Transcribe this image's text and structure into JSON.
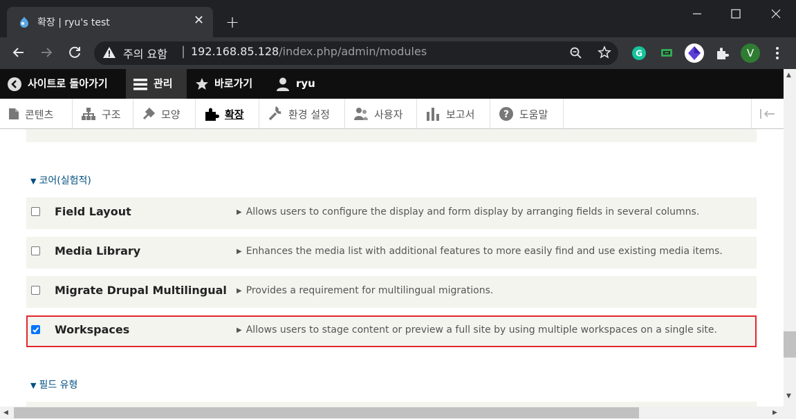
{
  "browser": {
    "tab_title": "확장 | ryu's test",
    "close_glyph": "✕",
    "new_tab_glyph": "+",
    "security_label": "주의 요함",
    "url_host": "192.168.85.128",
    "url_path": "/index.php/admin/modules",
    "profile_initial": "V"
  },
  "admin_toolbar": {
    "back_to_site": "사이트로 돌아가기",
    "manage": "관리",
    "shortcuts": "바로가기",
    "user": "ryu"
  },
  "tray": {
    "items": [
      {
        "label": "콘텐츠",
        "icon": "file-icon"
      },
      {
        "label": "구조",
        "icon": "structure-icon"
      },
      {
        "label": "모양",
        "icon": "brush-icon"
      },
      {
        "label": "확장",
        "icon": "puzzle-icon"
      },
      {
        "label": "환경 설정",
        "icon": "wrench-icon"
      },
      {
        "label": "사용자",
        "icon": "people-icon"
      },
      {
        "label": "보고서",
        "icon": "bar-chart-icon"
      },
      {
        "label": "도움말",
        "icon": "help-icon"
      }
    ],
    "active_index": 3
  },
  "sections": {
    "core_experimental": "코어(실험적)",
    "field_types": "필드 유형"
  },
  "modules": [
    {
      "name": "Field Layout",
      "description": "Allows users to configure the display and form display by arranging fields in several columns.",
      "checked": false
    },
    {
      "name": "Media Library",
      "description": "Enhances the media list with additional features to more easily find and use existing media items.",
      "checked": false
    },
    {
      "name": "Migrate Drupal Multilingual",
      "description": "Provides a requirement for multilingual migrations.",
      "checked": false
    },
    {
      "name": "Workspaces",
      "description": "Allows users to stage content or preview a full site by using multiple workspaces on a single site.",
      "checked": true
    }
  ],
  "colors": {
    "highlight_border": "#e2262d",
    "section_link": "#004f80",
    "row_bg": "#f3f4ee",
    "checkbox_checked": "#0075ff"
  }
}
